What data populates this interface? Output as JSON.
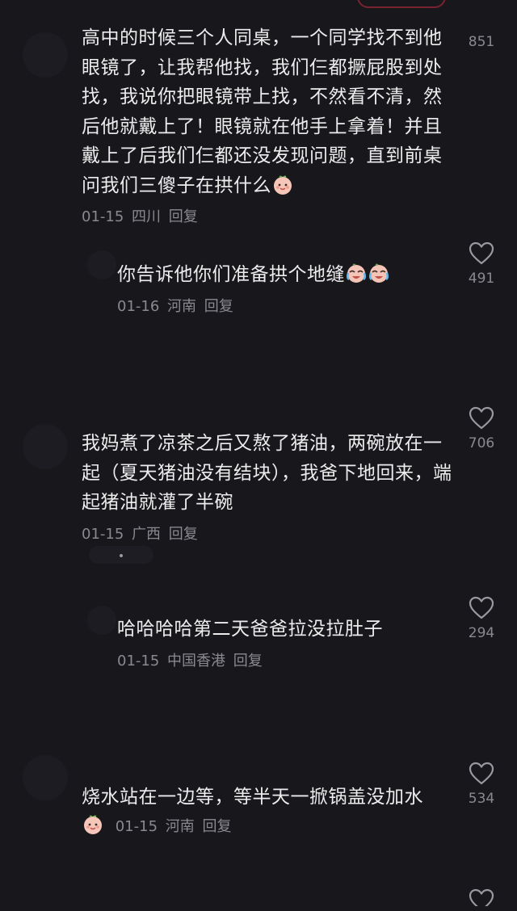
{
  "comments": [
    {
      "text": "高中的时候三个人同桌，一个同学找不到他眼镜了，让我帮他找，我们仨都撅屁股到处找，我说你把眼镜带上找，不然看不清，然后他就戴上了！眼镜就在他手上拿着！并且戴上了后我们仨都还没发现问题，直到前桌问我们三傻子在拱什么",
      "date": "01-15",
      "location": "四川",
      "reply": "回复",
      "likes": "851"
    },
    {
      "text": "你告诉他你们准备拱个地缝",
      "date": "01-16",
      "location": "河南",
      "reply": "回复",
      "likes": "491"
    },
    {
      "text": "我妈煮了凉茶之后又熬了猪油，两碗放在一起（夏天猪油没有结块），我爸下地回来，端起猪油就灌了半碗",
      "date": "01-15",
      "location": "广西",
      "reply": "回复",
      "likes": "706"
    },
    {
      "text": "哈哈哈哈第二天爸爸拉没拉肚子",
      "date": "01-15",
      "location": "中国香港",
      "reply": "回复",
      "likes": "294"
    },
    {
      "text": "烧水站在一边等，等半天一掀锅盖没加水",
      "date": "01-15",
      "location": "河南",
      "reply": "回复",
      "likes": "534"
    }
  ],
  "icons": {
    "like": "heart-outline-icon",
    "emoji_smile": "peach-smile-emoji",
    "emoji_cry": "crying-laugh-emoji"
  },
  "colors": {
    "background": "#18171c",
    "text": "#ececec",
    "meta": "#8a8990"
  }
}
